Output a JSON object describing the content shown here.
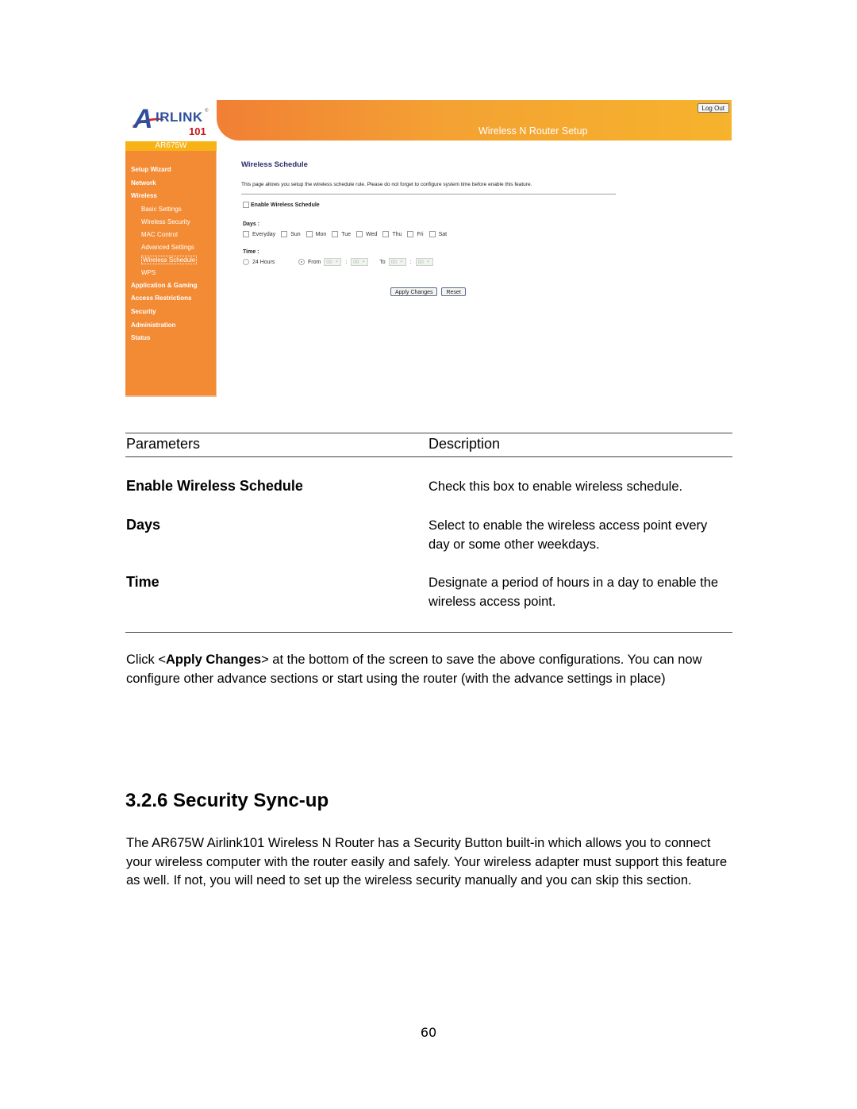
{
  "router_ui": {
    "logo": {
      "letter_a": "A",
      "brand": "IRLINK",
      "registered": "®",
      "number": "101"
    },
    "model": "AR675W",
    "header_title": "Wireless N Router Setup",
    "logout_label": "Log Out",
    "sidebar": {
      "items": [
        {
          "label": "Setup Wizard"
        },
        {
          "label": "Network"
        },
        {
          "label": "Wireless",
          "children": [
            {
              "label": "Basic Settings"
            },
            {
              "label": "Wireless Security"
            },
            {
              "label": "MAC Control"
            },
            {
              "label": "Advanced Settings"
            },
            {
              "label": "Wireless Schedule",
              "active": true
            },
            {
              "label": "WPS"
            }
          ]
        },
        {
          "label": "Application & Gaming"
        },
        {
          "label": "Access Restrictions"
        },
        {
          "label": "Security"
        },
        {
          "label": "Administration"
        },
        {
          "label": "Status"
        }
      ]
    },
    "content": {
      "title": "Wireless Schedule",
      "description": "This page allows you setup the wireless schedule rule. Please do not forget to configure system time before enable this feature.",
      "enable_label": "Enable Wireless Schedule",
      "enable_checked": false,
      "days_label": "Days :",
      "days": [
        "Everyday",
        "Sun",
        "Mon",
        "Tue",
        "Wed",
        "Thu",
        "Fri",
        "Sat"
      ],
      "time_label": "Time :",
      "time_24h_label": "24 Hours",
      "time_from_label": "From",
      "time_to_label": "To",
      "time_mode": "From",
      "from_hour": "00",
      "from_minute": "00",
      "to_hour": "00",
      "to_minute": "00",
      "colon": ":",
      "apply_label": "Apply Changes",
      "reset_label": "Reset"
    }
  },
  "table": {
    "header_param": "Parameters",
    "header_desc": "Description",
    "rows": [
      {
        "name": "Enable Wireless Schedule",
        "desc": "Check this box to enable wireless schedule."
      },
      {
        "name": "Days",
        "desc": "Select to enable the wireless access point every day or some other weekdays."
      },
      {
        "name": "Time",
        "desc": "Designate a period of hours in a day to enable the wireless access point."
      }
    ]
  },
  "apply_paragraph": {
    "prefix": "Click <",
    "bold": "Apply Changes",
    "suffix": "> at the bottom of the screen to save the above configurations. You can now configure other advance sections or start using the router (with the advance settings in place)"
  },
  "section": {
    "heading": "3.2.6 Security Sync-up",
    "body": "The AR675W Airlink101 Wireless N Router has a Security Button built-in which allows you to connect your wireless computer with the router easily and safely. Your wireless adapter must support this feature as well. If not, you will need to set up the wireless security manually and you can skip this section."
  },
  "page_number": "60"
}
